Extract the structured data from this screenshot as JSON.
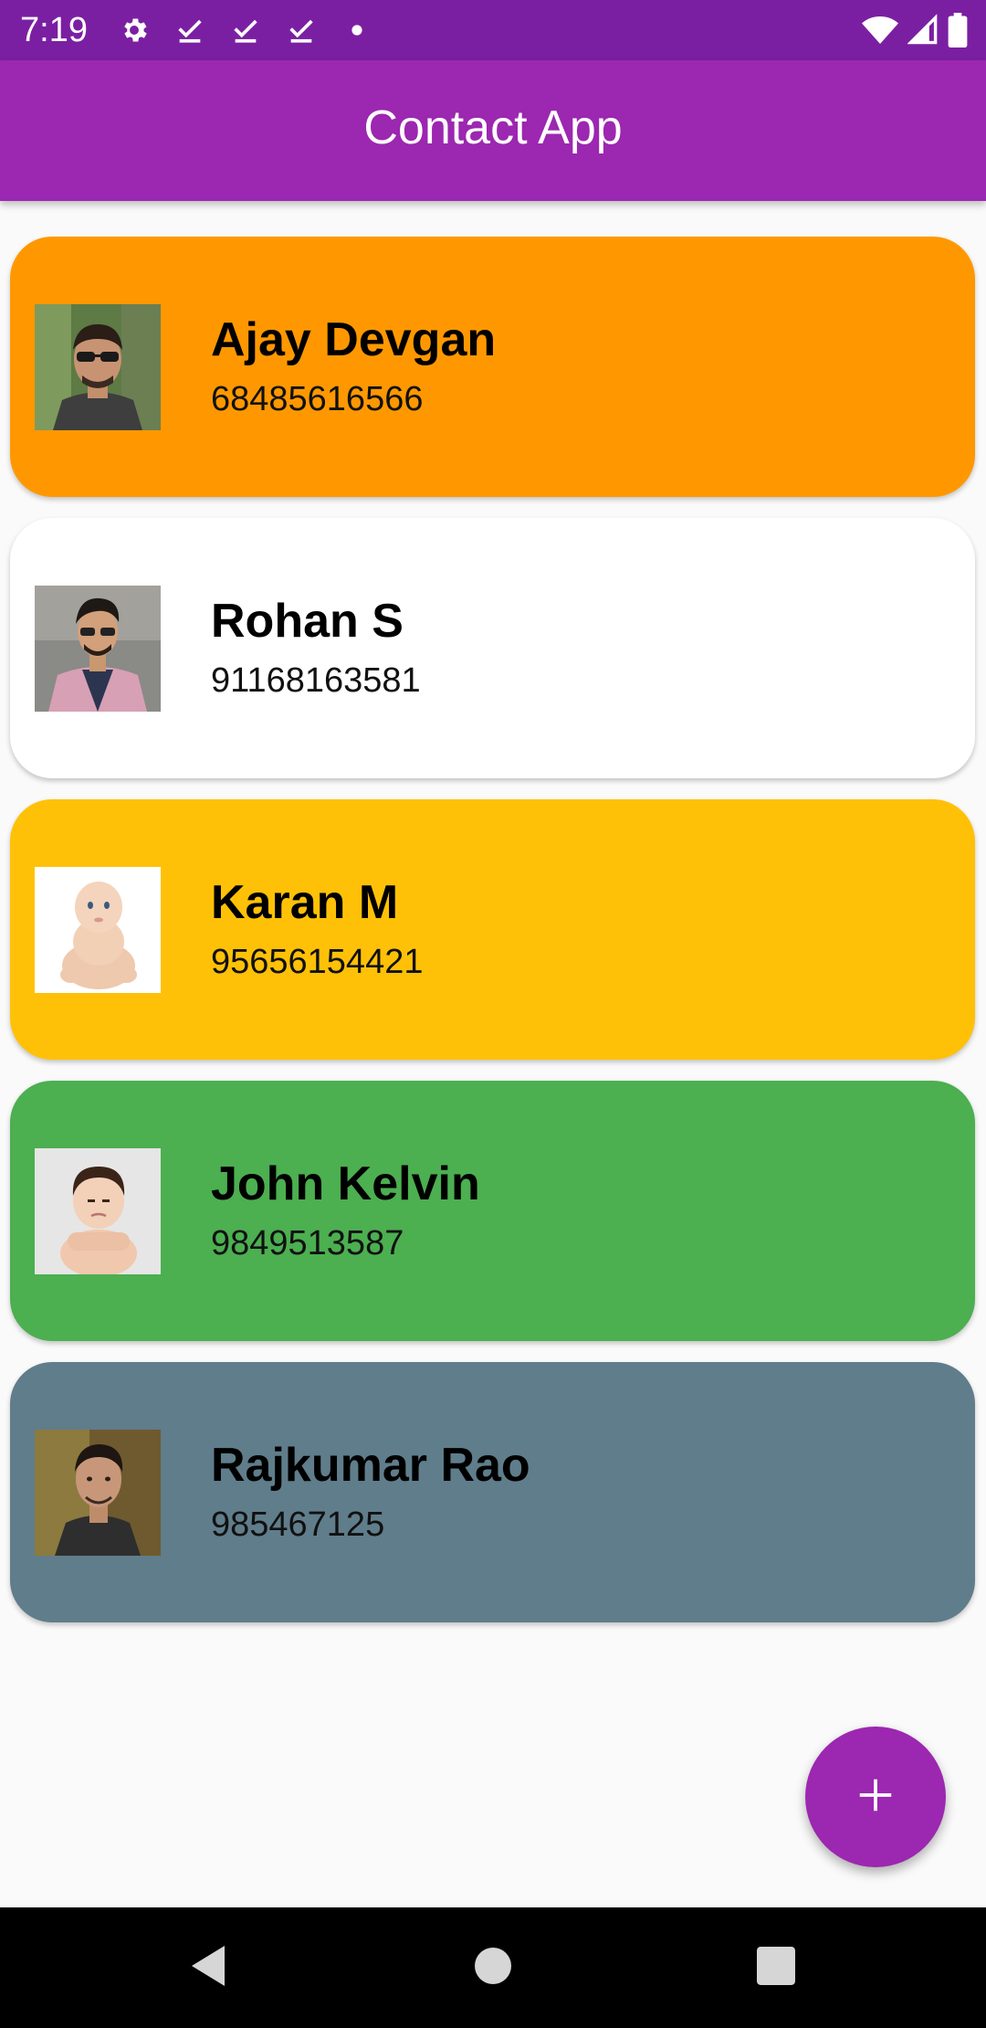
{
  "status_bar": {
    "time": "7:19",
    "icons_left": [
      "settings-icon",
      "download-done-icon",
      "download-done-icon",
      "download-done-icon",
      "dot-icon"
    ],
    "icons_right": [
      "wifi-icon",
      "cell-signal-icon",
      "battery-icon"
    ],
    "background": "#7B1FA2"
  },
  "app_bar": {
    "title": "Contact App",
    "background": "#9C27B0"
  },
  "contacts": [
    {
      "name": "Ajay Devgan",
      "phone": "68485616566",
      "color": "#FF9800"
    },
    {
      "name": "Rohan S",
      "phone": "91168163581",
      "color": "#FFFFFF"
    },
    {
      "name": "Karan M",
      "phone": "95656154421",
      "color": "#FFC107"
    },
    {
      "name": "John Kelvin",
      "phone": "9849513587",
      "color": "#4CAF50"
    },
    {
      "name": "Rajkumar Rao",
      "phone": "985467125",
      "color": "#607D8B"
    }
  ],
  "fab": {
    "icon": "plus-icon",
    "color": "#9C27B0"
  },
  "nav_bar": {
    "buttons": [
      "back-icon",
      "home-icon",
      "recents-icon"
    ]
  }
}
